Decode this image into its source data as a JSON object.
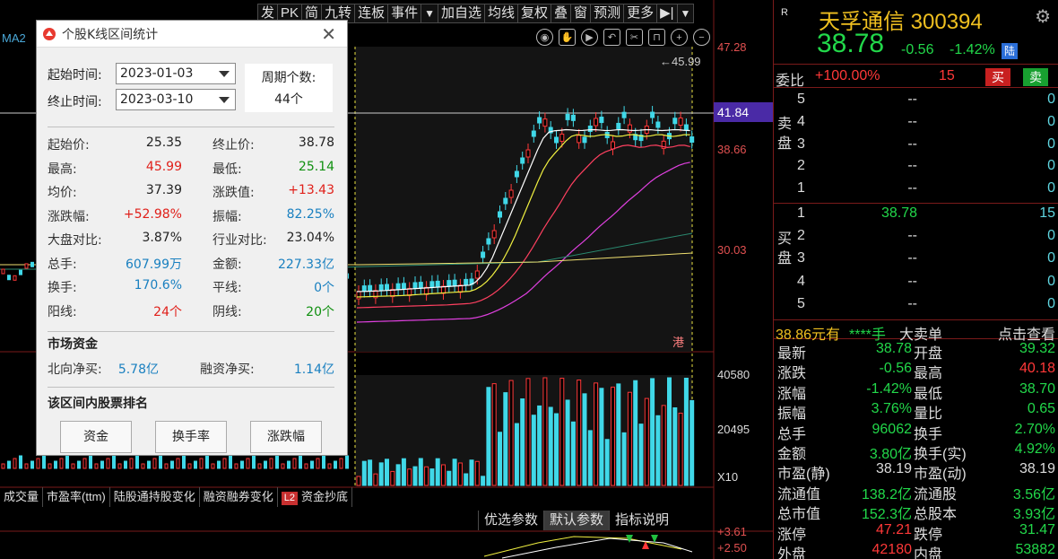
{
  "toolbar": {
    "items": [
      "发",
      "PK",
      "简",
      "九转",
      "连板",
      "事件",
      "▼",
      "加自选",
      "均线",
      "复权",
      "叠",
      "窗",
      "预测",
      "更多",
      "▶|",
      "▼"
    ]
  },
  "chart": {
    "ma_label": "MA2",
    "price_axis": [
      "47.28",
      "38.66",
      "30.03"
    ],
    "current_price_tag": "41.84",
    "high_marker": "45.99",
    "vol_axis": [
      "40580",
      "20495",
      "X10"
    ],
    "ind_axis": [
      "3.61",
      "2.50"
    ],
    "hk_marker": "港"
  },
  "indicator_tabs": [
    "成交量",
    "市盈率(ttm)",
    "陆股通持股变化",
    "融资融券变化",
    "资金抄底"
  ],
  "l2_badge": "L2",
  "params": {
    "items": [
      "优选参数",
      "默认参数",
      "指标说明"
    ]
  },
  "popup": {
    "title": "个股K线区间统计",
    "start_label": "起始时间:",
    "start_value": "2023-01-03",
    "end_label": "终止时间:",
    "end_value": "2023-03-10",
    "period_label": "周期个数:",
    "period_value": "44个",
    "stats": [
      {
        "l1": "起始价:",
        "v1": "25.35",
        "l2": "终止价:",
        "v2": "38.78"
      },
      {
        "l1": "最高:",
        "v1": "45.99",
        "l2": "最低:",
        "v2": "25.14"
      },
      {
        "l1": "均价:",
        "v1": "37.39",
        "l2": "涨跌值:",
        "v2": "+13.43"
      },
      {
        "l1": "涨跌幅:",
        "v1": "+52.98%",
        "l2": "振幅:",
        "v2": "82.25%"
      },
      {
        "l1": "大盘对比:",
        "v1": "3.87%",
        "l2": "行业对比:",
        "v2": "23.04%"
      },
      {
        "l1": "总手:",
        "v1": "607.99万",
        "l2": "金额:",
        "v2": "227.33亿"
      },
      {
        "l1": "换手:",
        "v1": "170.6%",
        "l2": "平线:",
        "v2": "0个"
      },
      {
        "l1": "阳线:",
        "v1": "24个",
        "l2": "阴线:",
        "v2": "20个"
      }
    ],
    "market_title": "市场资金",
    "north_label": "北向净买:",
    "north_value": "5.78亿",
    "margin_label": "融资净买:",
    "margin_value": "1.14亿",
    "rank_title": "该区间内股票排名",
    "buttons": [
      "资金",
      "换手率",
      "涨跌幅"
    ]
  },
  "quote": {
    "r_badge": "R",
    "name": "天孚通信 300394",
    "price": "38.78",
    "change": "-0.56",
    "change_pct": "-1.42%",
    "lu_badge": "陆",
    "wb_label": "委比",
    "wb_value": "+100.00%",
    "wb_count": "15",
    "buy_btn": "买",
    "sell_btn": "卖",
    "sell_side": "卖盘",
    "buy_side": "买盘",
    "asks": [
      {
        "idx": "5",
        "price": "--",
        "vol": "0"
      },
      {
        "idx": "4",
        "price": "--",
        "vol": "0"
      },
      {
        "idx": "3",
        "price": "--",
        "vol": "0"
      },
      {
        "idx": "2",
        "price": "--",
        "vol": "0"
      },
      {
        "idx": "1",
        "price": "--",
        "vol": "0"
      }
    ],
    "bids": [
      {
        "idx": "1",
        "price": "38.78",
        "vol": "15"
      },
      {
        "idx": "2",
        "price": "--",
        "vol": "0"
      },
      {
        "idx": "3",
        "price": "--",
        "vol": "0"
      },
      {
        "idx": "4",
        "price": "--",
        "vol": "0"
      },
      {
        "idx": "5",
        "price": "--",
        "vol": "0"
      }
    ],
    "big_trade": "38.86元有",
    "big_trade_mask": "****手",
    "big_trade_type": "大卖单",
    "big_trade_link": "点击查看",
    "rows": [
      {
        "l1": "最新",
        "v1": "38.78",
        "c1": "green",
        "l2": "开盘",
        "v2": "39.32",
        "c2": "green"
      },
      {
        "l1": "涨跌",
        "v1": "-0.56",
        "c1": "green",
        "l2": "最高",
        "v2": "40.18",
        "c2": "red"
      },
      {
        "l1": "涨幅",
        "v1": "-1.42%",
        "c1": "green",
        "l2": "最低",
        "v2": "38.70",
        "c2": "green"
      },
      {
        "l1": "振幅",
        "v1": "3.76%",
        "c1": "green",
        "l2": "量比",
        "v2": "0.65",
        "c2": "green"
      },
      {
        "l1": "总手",
        "v1": "96062",
        "c1": "green",
        "l2": "换手",
        "v2": "2.70%",
        "c2": "green"
      },
      {
        "l1": "金额",
        "v1": "3.80亿",
        "c1": "green",
        "l2": "换手(实)",
        "v2": "4.92%",
        "c2": "green"
      },
      {
        "l1": "市盈(静)",
        "v1": "38.19",
        "c1": "white",
        "l2": "市盈(动)",
        "v2": "38.19",
        "c2": "white"
      },
      {
        "l1": "流通值",
        "v1": "138.2亿",
        "c1": "green",
        "l2": "流通股",
        "v2": "3.56亿",
        "c2": "green"
      },
      {
        "l1": "总市值",
        "v1": "152.3亿",
        "c1": "green",
        "l2": "总股本",
        "v2": "3.93亿",
        "c2": "green"
      },
      {
        "l1": "涨停",
        "v1": "47.21",
        "c1": "red",
        "l2": "跌停",
        "v2": "31.47",
        "c2": "green"
      },
      {
        "l1": "外盘",
        "v1": "42180",
        "c1": "red",
        "l2": "内盘",
        "v2": "53882",
        "c2": "green"
      }
    ]
  },
  "colors": {
    "up": "#ff3838",
    "down": "#40d8e8",
    "ma5": "#ffffff",
    "ma10": "#f0f040",
    "ma20": "#ff4060",
    "ma60": "#e040e0",
    "ma120": "#2a8a70",
    "ma250": "#f0e070"
  }
}
